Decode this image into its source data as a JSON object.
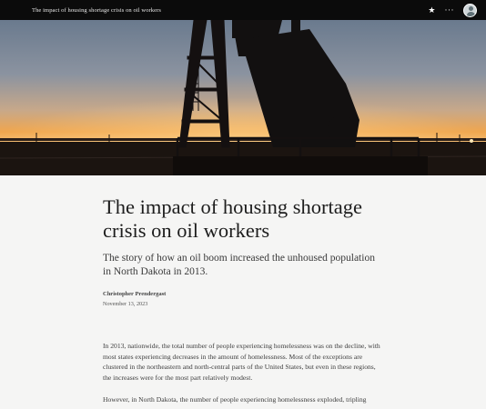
{
  "topbar": {
    "title": "The impact of housing shortage crisis on oil workers",
    "star_icon": "★",
    "more_icon": "···"
  },
  "hero": {
    "image": "oil pumpjack silhouette at sunset",
    "colors": {
      "sky_top": "#6d7c90",
      "sky_horizon": "#f0a24a",
      "ground": "#1c1410"
    }
  },
  "article": {
    "headline": "The impact of housing shortage crisis on oil workers",
    "subheadline": "The story of how an oil boom increased the unhoused population in North Dakota in 2013.",
    "author": "Christopher Prendergast",
    "date": "November 13, 2023",
    "paragraphs": [
      "In 2013, nationwide, the total number of people experiencing homelessness was on the decline, with most states experiencing decreases in the amount of homelessness. Most of the exceptions are clustered in the northeastern and north-central parts of the United States, but even in these regions, the increases were for the most part relatively modest.",
      "However, in North Dakota, the number of people experiencing homelessness exploded, tripling"
    ]
  }
}
